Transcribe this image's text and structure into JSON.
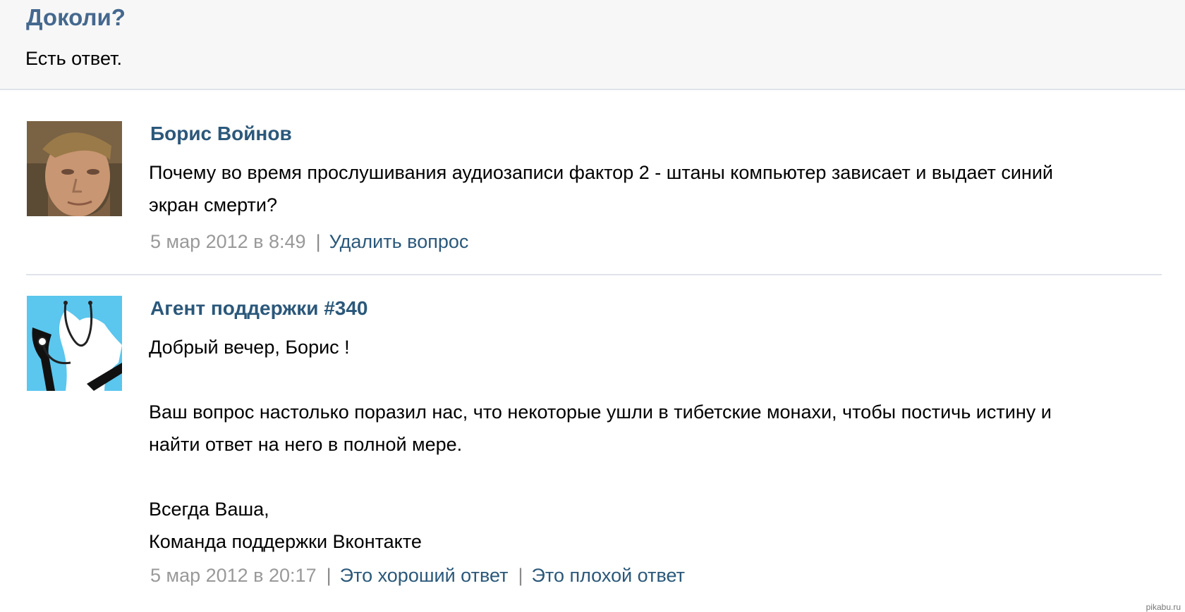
{
  "header": {
    "title": "Доколи?",
    "subtitle": "Есть ответ."
  },
  "posts": [
    {
      "author": "Борис Войнов",
      "lines": [
        "Почему во время прослушивания аудиозаписи фактор 2 - штаны компьютер зависает и выдает синий",
        "экран смерти?"
      ],
      "date": "5 мар 2012 в 8:49",
      "actions": [
        "Удалить вопрос"
      ]
    },
    {
      "author": "Агент поддержки #340",
      "lines": [
        "Добрый вечер, Борис !",
        "",
        "Ваш вопрос настолько поразил нас, что некоторые ушли в тибетские монахи, чтобы постичь истину и",
        "найти ответ на него в полной мере.",
        "",
        "Всегда Ваша,",
        "Команда поддержки Вконтакте"
      ],
      "date": "5 мар 2012 в 20:17",
      "actions": [
        "Это хороший ответ",
        "Это плохой ответ"
      ]
    }
  ],
  "watermark": "pikabu.ru",
  "colors": {
    "link": "#2b587a",
    "title": "#45688e",
    "date": "#999999",
    "agent_avatar_bg": "#5bc6ee"
  }
}
